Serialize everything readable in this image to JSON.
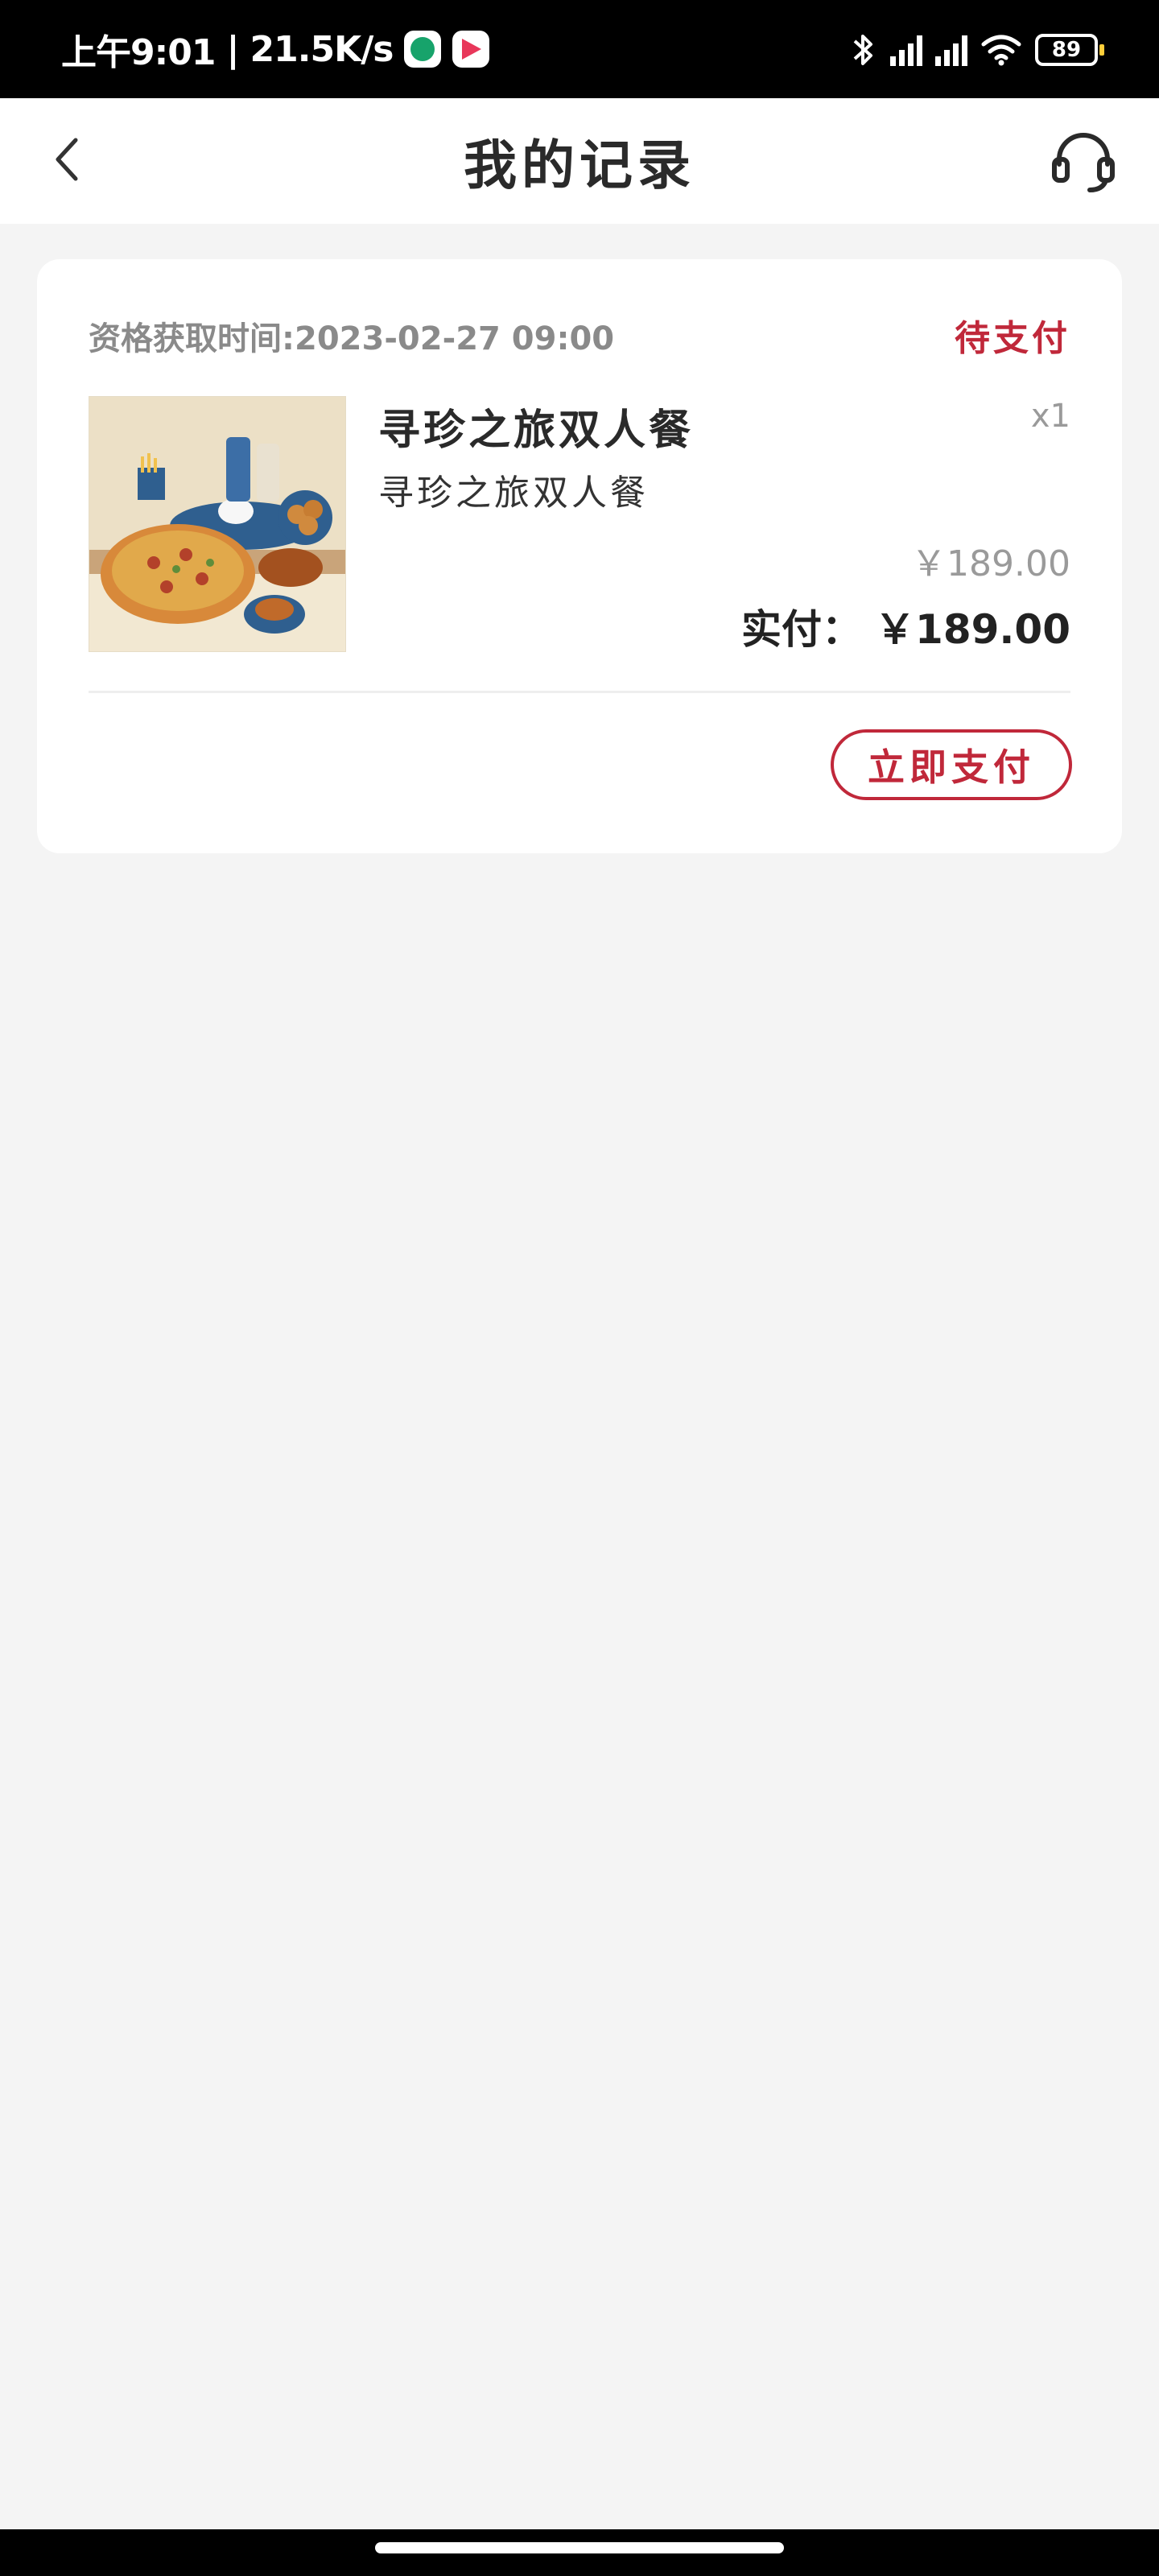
{
  "status_bar": {
    "time": "上午9:01",
    "separator": "|",
    "net_speed": "21.5K/s",
    "battery": "89",
    "icons": [
      "green-app-icon",
      "red-app-icon",
      "bluetooth-icon",
      "hd-signal-icon",
      "hd-signal-icon",
      "wifi-icon",
      "battery-icon"
    ]
  },
  "header": {
    "title": "我的记录",
    "back_icon": "chevron-left-icon",
    "service_icon": "headset-icon"
  },
  "record": {
    "acquire_label": "资格获取时间:",
    "acquire_time": "2023-02-27 09:00",
    "status": "待支付",
    "product_name": "寻珍之旅双人餐",
    "product_subtitle": "寻珍之旅双人餐",
    "quantity": "x1",
    "original_price": "￥189.00",
    "paid_label": "实付：",
    "paid_amount": "￥189.00",
    "pay_button": "立即支付",
    "colors": {
      "accent": "#c0283a",
      "muted": "#9a9a9a"
    }
  }
}
